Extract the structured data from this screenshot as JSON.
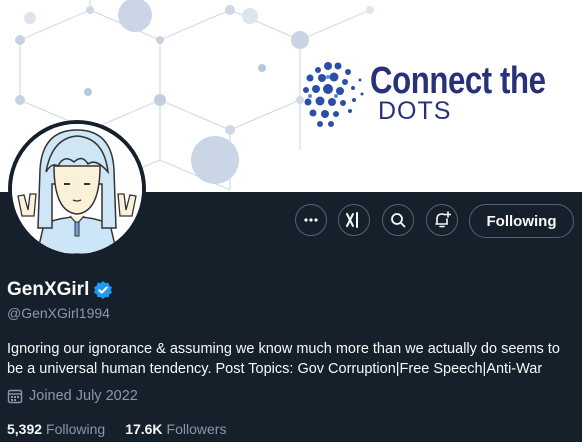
{
  "banner": {
    "logo_title": "Connect the",
    "logo_subtitle": "DOTS"
  },
  "profile": {
    "display_name": "GenXGirl",
    "handle": "@GenXGirl1994",
    "bio": "Ignoring our ignorance & assuming we know much more than we actually do seems to be a universal human tendency. Post Topics: Gov Corruption|Free Speech|Anti-War",
    "joined": "Joined July 2022",
    "following_count": "5,392",
    "following_label": "Following",
    "followers_count": "17.6K",
    "followers_label": "Followers"
  },
  "actions": {
    "more_icon": "more-icon",
    "grok_icon": "grok-icon",
    "search_icon": "search-icon",
    "notify_icon": "bell-plus-icon",
    "follow_label": "Following"
  },
  "colors": {
    "background": "#15202b",
    "verified": "#1d9bf0",
    "muted": "#8b98a5",
    "logo": "#27327a"
  }
}
